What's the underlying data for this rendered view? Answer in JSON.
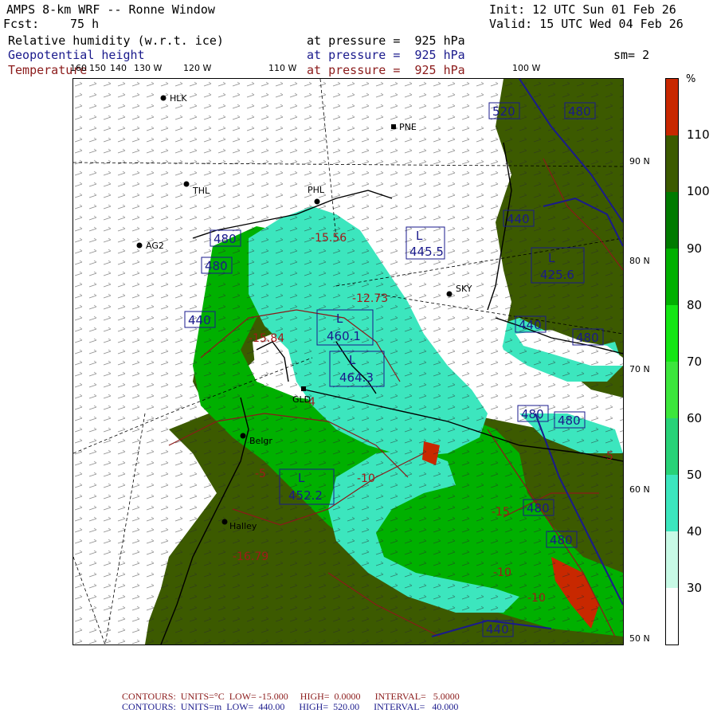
{
  "header": {
    "title": "AMPS 8-km WRF -- Ronne Window",
    "init": "Init: 12 UTC Sun 01 Feb 26",
    "fcst_label": "Fcst:",
    "fcst_value": "75 h",
    "valid": "Valid: 15 UTC Wed 04 Feb 26",
    "smoothing": "sm= 2"
  },
  "fields": [
    {
      "name": "Relative humidity (w.r.t. ice)",
      "level": "at pressure =  925 hPa",
      "color": "#000000"
    },
    {
      "name": "Geopotential height",
      "level": "at pressure =  925 hPa",
      "color": "#1a1a8c"
    },
    {
      "name": "Temperature",
      "level": "at pressure =  925 hPa",
      "color": "#8b1a1a"
    }
  ],
  "longitudes": [
    "160",
    "150",
    "140",
    "130 W",
    "120 W",
    "110 W",
    "100 W"
  ],
  "latitudes": [
    "90 N",
    "80 N",
    "70 N",
    "60 N",
    "50 N"
  ],
  "stations": [
    "HLK",
    "PNE",
    "THL",
    "PHL",
    "AG2",
    "SKY",
    "Halley",
    "Belgr",
    "GLD"
  ],
  "height_labels": [
    "480",
    "520",
    "480",
    "440",
    "480",
    "440",
    "480",
    "480",
    "440",
    "480",
    "480",
    "480",
    "440",
    "440"
  ],
  "pressure_centers": [
    {
      "type": "L",
      "value": "445.5"
    },
    {
      "type": "L",
      "value": "425.6"
    },
    {
      "type": "L",
      "value": "460.1"
    },
    {
      "type": "L",
      "value": "464.3"
    },
    {
      "type": "L",
      "value": "452.2"
    }
  ],
  "temperature_values": [
    "-15.56",
    "-12.73",
    "-15.84",
    "-16.79",
    "-10",
    "-15",
    "-5",
    "-10",
    "-10",
    "-4",
    "-5"
  ],
  "colorbar": {
    "unit": "%",
    "levels": [
      "110",
      "100",
      "90",
      "80",
      "70",
      "60",
      "50",
      "40",
      "30"
    ],
    "colors": [
      "#c82800",
      "#3c5a00",
      "#007a00",
      "#00b000",
      "#14e614",
      "#3ce63c",
      "#28d278",
      "#3ce6be",
      "#c8fae6",
      "#ffffff"
    ]
  },
  "footer": {
    "temp": {
      "contours": "CONTOURS:",
      "units": "UNITS=°C",
      "low": "LOW= -15.000",
      "high": "HIGH=  0.0000",
      "interval": "INTERVAL=   5.0000"
    },
    "height": {
      "contours": "CONTOURS:",
      "units": "UNITS=m",
      "low": "LOW=  440.00",
      "high": "HIGH=  520.00",
      "interval": "INTERVAL=   40.000"
    }
  }
}
